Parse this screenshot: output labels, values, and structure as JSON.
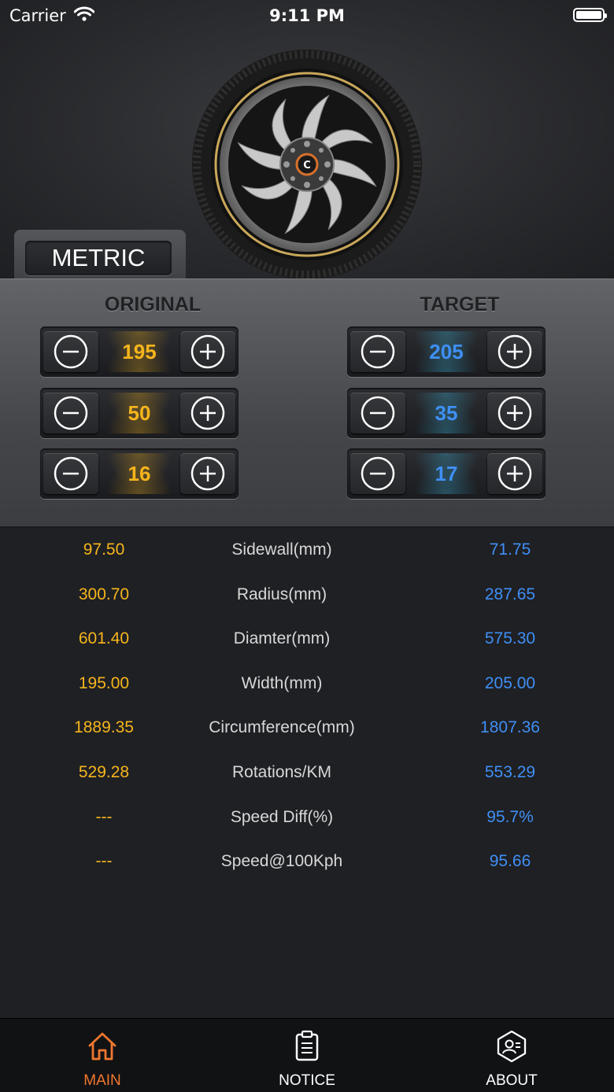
{
  "status_bar": {
    "carrier": "Carrier",
    "time": "9:11 PM"
  },
  "unit_toggle": {
    "label": "METRIC"
  },
  "columns": {
    "original": "ORIGINAL",
    "target": "TARGET"
  },
  "original": {
    "width": "195",
    "aspect": "50",
    "rim": "16"
  },
  "target": {
    "width": "205",
    "aspect": "35",
    "rim": "17"
  },
  "results": [
    {
      "label": "Sidewall(mm)",
      "original": "97.50",
      "target": "71.75"
    },
    {
      "label": "Radius(mm)",
      "original": "300.70",
      "target": "287.65"
    },
    {
      "label": "Diamter(mm)",
      "original": "601.40",
      "target": "575.30"
    },
    {
      "label": "Width(mm)",
      "original": "195.00",
      "target": "205.00"
    },
    {
      "label": "Circumference(mm)",
      "original": "1889.35",
      "target": "1807.36"
    },
    {
      "label": "Rotations/KM",
      "original": "529.28",
      "target": "553.29"
    },
    {
      "label": "Speed Diff(%)",
      "original": "---",
      "target": "95.7%"
    },
    {
      "label": "Speed@100Kph",
      "original": "---",
      "target": "95.66"
    }
  ],
  "tabs": [
    {
      "label": "MAIN",
      "icon": "home-icon",
      "active": true
    },
    {
      "label": "NOTICE",
      "icon": "clipboard-icon",
      "active": false
    },
    {
      "label": "ABOUT",
      "icon": "profile-icon",
      "active": false
    }
  ],
  "colors": {
    "original": "#f6b51c",
    "target": "#3f8ff5",
    "active_tab": "#f0772e"
  }
}
